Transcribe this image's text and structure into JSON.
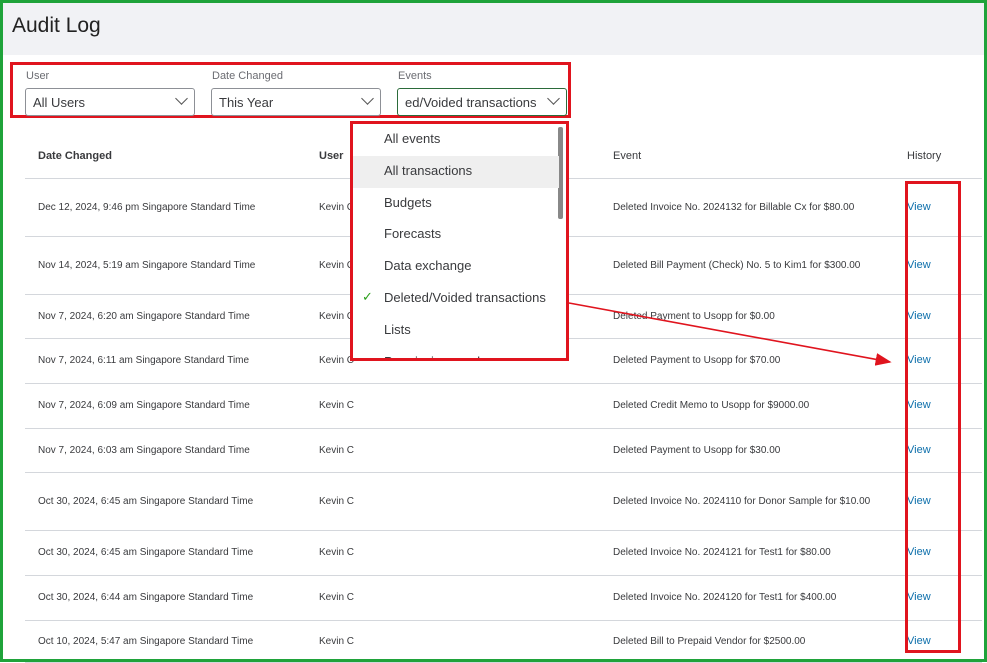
{
  "title": "Audit Log",
  "filters": {
    "user": {
      "label": "User",
      "value": "All Users"
    },
    "date": {
      "label": "Date Changed",
      "value": "This Year"
    },
    "events": {
      "label": "Events",
      "value": "ed/Voided transactions"
    }
  },
  "dropdown": {
    "items": [
      "All events",
      "All transactions",
      "Budgets",
      "Forecasts",
      "Data exchange",
      "Deleted/Voided transactions",
      "Lists",
      "Permissions and"
    ],
    "selected_index": 5,
    "hover_index": 1
  },
  "table": {
    "headers": [
      "Date Changed",
      "User",
      "Event",
      "History"
    ],
    "rows": [
      {
        "date": "Dec 12, 2024, 9:46 pm Singapore Standard Time",
        "user": "Kevin C",
        "event": "Deleted Invoice No. 2024132 for Billable Cx for $80.00",
        "history": "View"
      },
      {
        "date": "Nov 14, 2024, 5:19 am Singapore Standard Time",
        "user": "Kevin C",
        "event": "Deleted Bill Payment (Check) No. 5 to Kim1 for $300.00",
        "history": "View"
      },
      {
        "date": "Nov 7, 2024, 6:20 am Singapore Standard Time",
        "user": "Kevin C",
        "event": "Deleted Payment to Usopp for $0.00",
        "history": "View"
      },
      {
        "date": "Nov 7, 2024, 6:11 am Singapore Standard Time",
        "user": "Kevin C",
        "event": "Deleted Payment to Usopp for $70.00",
        "history": "View"
      },
      {
        "date": "Nov 7, 2024, 6:09 am Singapore Standard Time",
        "user": "Kevin C",
        "event": "Deleted Credit Memo to Usopp for $9000.00",
        "history": "View"
      },
      {
        "date": "Nov 7, 2024, 6:03 am Singapore Standard Time",
        "user": "Kevin C",
        "event": "Deleted Payment to Usopp for $30.00",
        "history": "View"
      },
      {
        "date": "Oct 30, 2024, 6:45 am Singapore Standard Time",
        "user": "Kevin C",
        "event": "Deleted Invoice No. 2024110 for Donor Sample for $10.00",
        "history": "View"
      },
      {
        "date": "Oct 30, 2024, 6:45 am Singapore Standard Time",
        "user": "Kevin C",
        "event": "Deleted Invoice No. 2024121 for Test1 for $80.00",
        "history": "View"
      },
      {
        "date": "Oct 30, 2024, 6:44 am Singapore Standard Time",
        "user": "Kevin C",
        "event": "Deleted Invoice No. 2024120 for Test1 for $400.00",
        "history": "View"
      },
      {
        "date": "Oct 10, 2024, 5:47 am Singapore Standard Time",
        "user": "Kevin C",
        "event": "Deleted Bill to Prepaid Vendor for $2500.00",
        "history": "View"
      }
    ]
  },
  "colors": {
    "highlight": "#e0141e",
    "frame": "#1fa33a",
    "link": "#0d6fab",
    "check": "#2ca01c"
  }
}
